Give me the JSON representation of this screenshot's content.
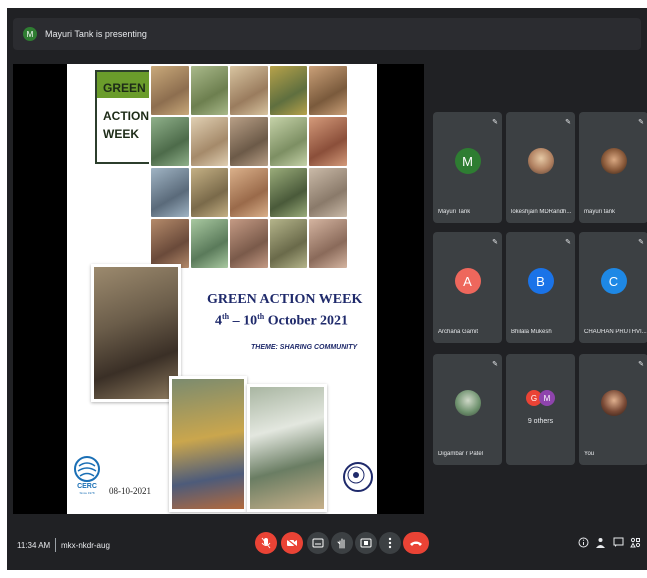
{
  "presenting": {
    "avatar_initial": "M",
    "text": "Mayuri Tank is presenting"
  },
  "slide": {
    "logo_lines": [
      "GREEN",
      "ACTION",
      "WEEK"
    ],
    "title": "GREEN ACTION WEEK",
    "dates_prefix": "4",
    "dates_sup1": "th",
    "dates_mid": " – 10",
    "dates_sup2": "th",
    "dates_suffix": " October 2021",
    "theme": "THEME: SHARING COMMUNITY",
    "footer_date": "08-10-2021",
    "org_label": "CERC",
    "org_sub": "Since 1978"
  },
  "participants": [
    {
      "name": "Mayuri Tank",
      "initial": "M",
      "color": "#2e7d32",
      "type": "letter"
    },
    {
      "name": "lokeshjain MDRandh...",
      "initial": "",
      "color": "#b08060",
      "type": "photo"
    },
    {
      "name": "mayuri tank",
      "initial": "",
      "color": "#8a5a3a",
      "type": "photo"
    },
    {
      "name": "Archana Gamit",
      "initial": "A",
      "color": "#ee675c",
      "type": "letter"
    },
    {
      "name": "Bhilala Mukesh",
      "initial": "B",
      "color": "#1a73e8",
      "type": "letter"
    },
    {
      "name": "CHAUHAN PRUTHVI...",
      "initial": "C",
      "color": "#1e88e5",
      "type": "letter"
    },
    {
      "name": "Digambar r Patel",
      "initial": "",
      "color": "#6b8f6b",
      "type": "photo"
    },
    {
      "name": "9 others",
      "initial": "",
      "color": "",
      "type": "others"
    },
    {
      "name": "You",
      "initial": "",
      "color": "#7a4a36",
      "type": "photo"
    }
  ],
  "others_avatars": [
    {
      "initial": "G",
      "color": "#ea4335"
    },
    {
      "initial": "M",
      "color": "#8e44ad"
    }
  ],
  "bottom_bar": {
    "time": "11:34 AM",
    "meeting_code": "mkx-nkdr-aug"
  },
  "icons": {
    "mic_off": "mic-off-icon",
    "cam_off": "camera-off-icon",
    "captions": "captions-icon",
    "raise_hand": "raise-hand-icon",
    "present": "present-icon",
    "more": "more-icon",
    "end_call": "end-call-icon",
    "info": "info-icon",
    "people": "people-icon",
    "chat": "chat-icon",
    "activities": "activities-icon"
  },
  "colors": {
    "background": "#202124",
    "tile": "#3c4043",
    "end_call": "#ea4335"
  }
}
